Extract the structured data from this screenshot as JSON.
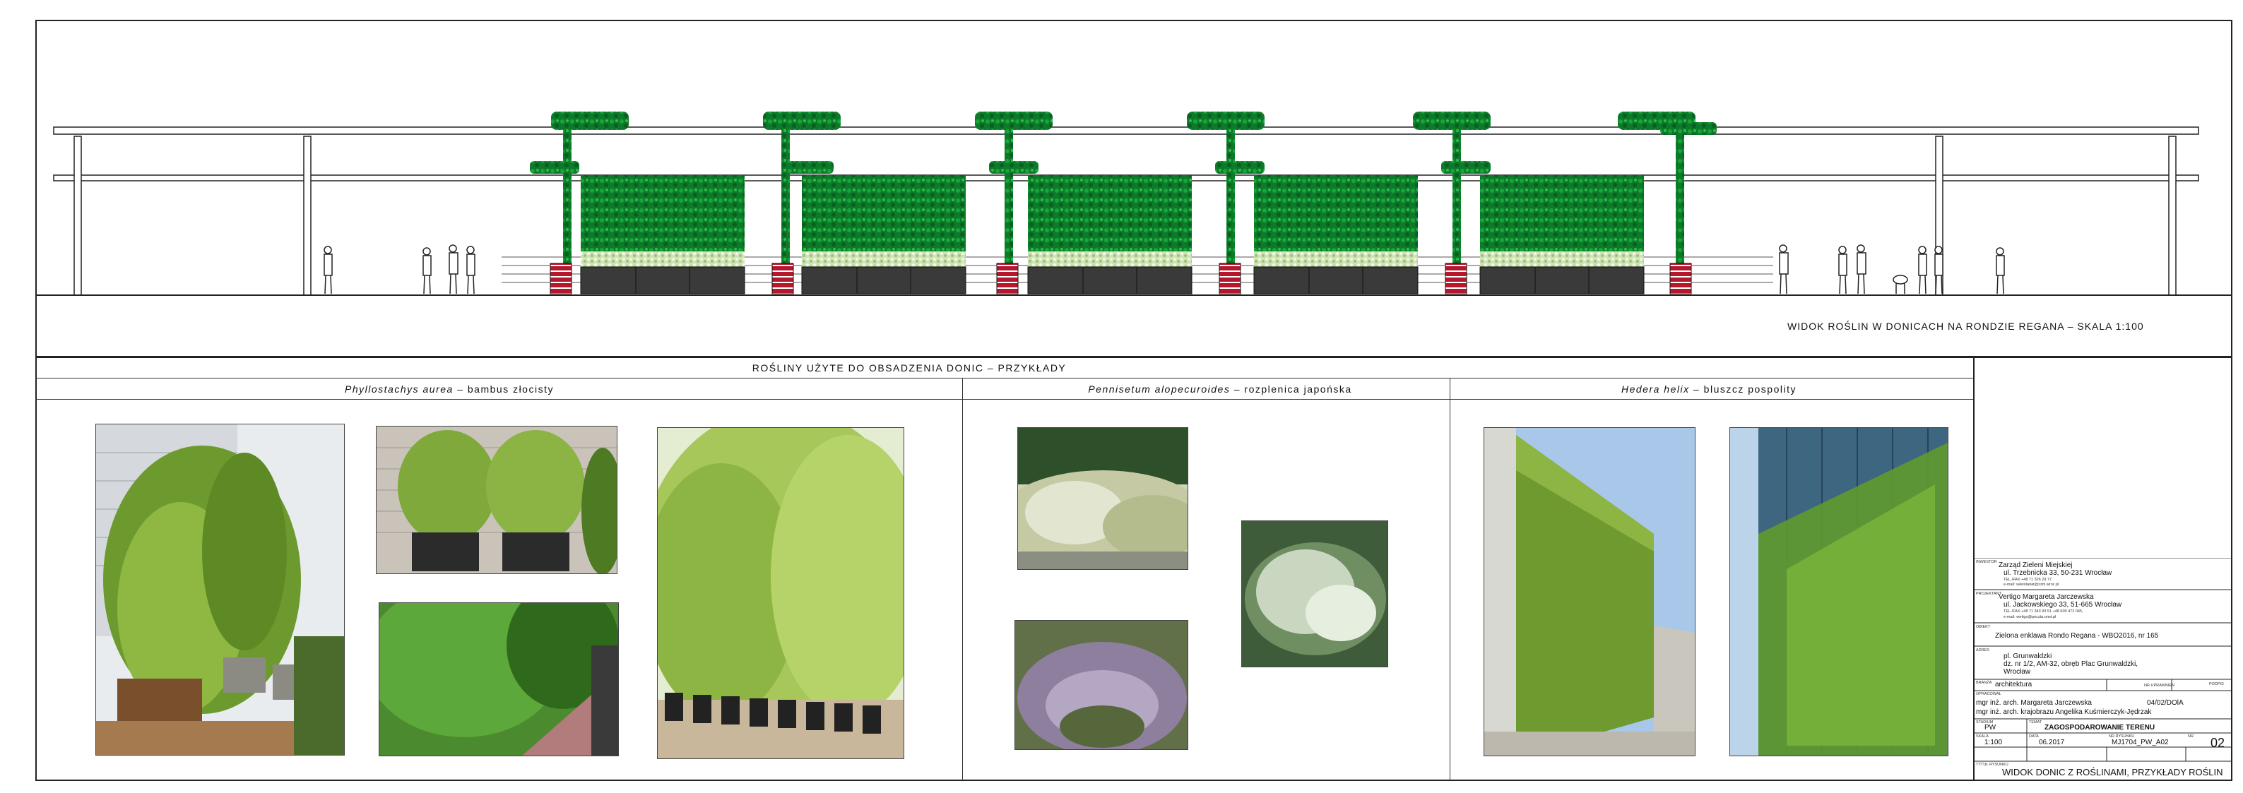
{
  "elevation": {
    "caption": "WIDOK ROŚLIN W DONICACH NA RONDZIE REGANA – SKALA 1:100"
  },
  "plants_section": {
    "title": "ROŚLINY UŻYTE DO OBSADZENIA DONIC – PRZYKŁADY",
    "columns": [
      {
        "species": "Phyllostachys aurea",
        "common": " – bambus złocisty"
      },
      {
        "species": "Pennisetum alopecuroides",
        "common": " – rozplenica japońska"
      },
      {
        "species": "Hedera helix",
        "common": " – bluszcz pospolity"
      }
    ]
  },
  "title_block": {
    "investor_label": "INWESTOR",
    "investor_name": "Zarząd Zieleni Miejskiej",
    "investor_address": "ul. Trzebnicka 33, 50-231 Wrocław",
    "investor_tel": "TEL./FAX +48 71 326 29 77",
    "investor_email": "e-mail: sekretariat@zzm.wroc.pl",
    "designer_label": "PROJEKTANT",
    "designer_name": "Vertigo Margareta Jarczewska",
    "designer_address": "ul. Jackowskiego 33, 51-665 Wrocław",
    "designer_tel": "TEL./FAX +48 71 343 93 51  +48 609 472 045,",
    "designer_email": "e-mail: vertigo@poczta.onet.pl",
    "object_label": "OBIEKT",
    "object_name": "Zielona enklawa Rondo Regana - WBO2016, nr 165",
    "address_label": "ADRES",
    "address_line1": "pl. Grunwaldzki",
    "address_line2": "dz. nr 1/2, AM-32, obręb Plac Grunwaldzki,",
    "address_line3": "Wrocław",
    "branch_label": "BRANŻA",
    "branch_value": "architektura",
    "sign_label": "NR UPRAWNIEŃ",
    "signature_label": "PODPIS",
    "prepared_label": "OPRACOWAŁ",
    "author1": "mgr inż. arch. Margareta Jarczewska",
    "author1_lic": "04/02/DOlA",
    "author2": "mgr inż. arch. krajobrazu Angelika Kuśmierczyk-Jędrzak",
    "stage_label": "STADIUM",
    "stage_value": "PW",
    "subject_label": "TEMAT",
    "subject_value": "ZAGOSPODAROWANIE TERENU",
    "scale_label": "SKALA",
    "scale_value": "1:100",
    "date_label": "DATA",
    "date_value": "06.2017",
    "drawing_no_label": "NR RYSUNKU",
    "drawing_no_value": "MJ1704_PW_A02",
    "sheet_label": "NR",
    "sheet_value": "02",
    "drawing_title_label": "TYTUŁ RYSUNKU",
    "drawing_title": "WIDOK DONIC Z ROŚLINAMI, PRZYKŁADY ROŚLIN"
  }
}
